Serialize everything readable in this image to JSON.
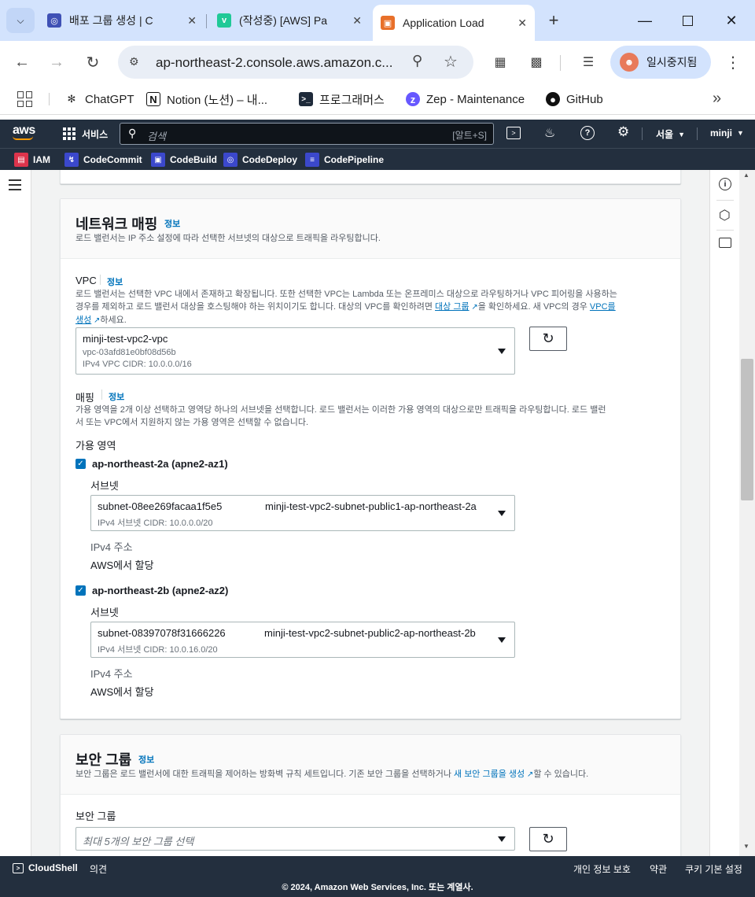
{
  "browser": {
    "tabs": [
      {
        "title": "배포 그룹 생성 | C",
        "favicon": "globe-icon",
        "color": "#3f51b5"
      },
      {
        "title": "(작성중) [AWS] Pa",
        "favicon": "velog-icon",
        "color": "#20c997"
      },
      {
        "title": "Application Load",
        "favicon": "ec2-icon",
        "color": "#e8702a"
      }
    ],
    "new_tab": "+",
    "url": "ap-northeast-2.console.aws.amazon.c...",
    "profile_label": "일시중지됨"
  },
  "bookmarks": [
    {
      "label": "ChatGPT",
      "icon": "chatgpt-icon"
    },
    {
      "label": "Notion (노션) – 내...",
      "icon": "notion-icon"
    },
    {
      "label": "프로그래머스",
      "icon": "programmers-icon"
    },
    {
      "label": "Zep - Maintenance",
      "icon": "zep-icon"
    },
    {
      "label": "GitHub",
      "icon": "github-icon"
    }
  ],
  "aws_header": {
    "logo": "aws",
    "services_label": "서비스",
    "search_placeholder": "검색",
    "search_shortcut": "[알트+S]",
    "region": "서울",
    "user": "minji"
  },
  "service_shortcuts": [
    {
      "label": "IAM",
      "color": "#dd344c"
    },
    {
      "label": "CodeCommit",
      "color": "#3b48cc"
    },
    {
      "label": "CodeBuild",
      "color": "#3b48cc"
    },
    {
      "label": "CodeDeploy",
      "color": "#3b48cc"
    },
    {
      "label": "CodePipeline",
      "color": "#3b48cc"
    }
  ],
  "network_mapping": {
    "title": "네트워크 매핑",
    "info": "정보",
    "description": "로드 밸런서는 IP 주소 설정에 따라 선택한 서브넷의 대상으로 트래픽을 라우팅합니다.",
    "vpc": {
      "label": "VPC",
      "info": "정보",
      "desc_1": "로드 밸런서는 선택한 VPC 내에서 존재하고 확장됩니다. 또한 선택한 VPC는 Lambda 또는 온프레미스 대상으로 라우팅하거나 VPC 피어링을 사용하는",
      "desc_2": "경우를 제외하고 로드 밸런서 대상을 호스팅해야 하는 위치이기도 합니다. 대상의 VPC를 확인하려면",
      "desc_link_1": "대상 그룹",
      "desc_3": "을 확인하세요. 새 VPC의 경우",
      "desc_link_2a": "VPC를",
      "desc_link_2b": "생성",
      "desc_4": "하세요.",
      "selected_name": "minji-test-vpc2-vpc",
      "selected_id": "vpc-03afd81e0bf08d56b",
      "selected_cidr": "IPv4 VPC CIDR: 10.0.0.0/16"
    },
    "mapping": {
      "label": "매핑",
      "info": "정보",
      "desc_1": "가용 영역을 2개 이상 선택하고 영역당 하나의 서브넷을 선택합니다. 로드 밸런서는 이러한 가용 영역의 대상으로만 트래픽을 라우팅합니다. 로드 밸런",
      "desc_2": "서 또는 VPC에서 지원하지 않는 가용 영역은 선택할 수 없습니다.",
      "az_heading": "가용 영역",
      "zones": [
        {
          "name": "ap-northeast-2a (apne2-az1)",
          "checked": true,
          "subnet_label": "서브넷",
          "subnet_id": "subnet-08ee269facaa1f5e5",
          "subnet_name": "minji-test-vpc2-subnet-public1-ap-northeast-2a",
          "subnet_cidr": "IPv4 서브넷 CIDR: 10.0.0.0/20",
          "ipv4_label": "IPv4 주소",
          "ipv4_value": "AWS에서 할당"
        },
        {
          "name": "ap-northeast-2b (apne2-az2)",
          "checked": true,
          "subnet_label": "서브넷",
          "subnet_id": "subnet-08397078f31666226",
          "subnet_name": "minji-test-vpc2-subnet-public2-ap-northeast-2b",
          "subnet_cidr": "IPv4 서브넷 CIDR: 10.0.16.0/20",
          "ipv4_label": "IPv4 주소",
          "ipv4_value": "AWS에서 할당"
        }
      ]
    }
  },
  "security_groups": {
    "title": "보안 그룹",
    "info": "정보",
    "desc_1": "보안 그룹은 로드 밸런서에 대한 트래픽을 제어하는 방화벽 규칙 세트입니다. 기존 보안 그룹을 선택하거나",
    "desc_link": "새 보안 그룹을 생성",
    "desc_2": "할 수 있습니다.",
    "field_label": "보안 그룹",
    "placeholder": "최대 5개의 보안 그룹 선택"
  },
  "footer": {
    "cloudshell": "CloudShell",
    "feedback": "의견",
    "privacy": "개인 정보 보호",
    "terms": "약관",
    "cookies": "쿠키 기본 설정",
    "copyright": "© 2024, Amazon Web Services, Inc. 또는 계열사."
  }
}
